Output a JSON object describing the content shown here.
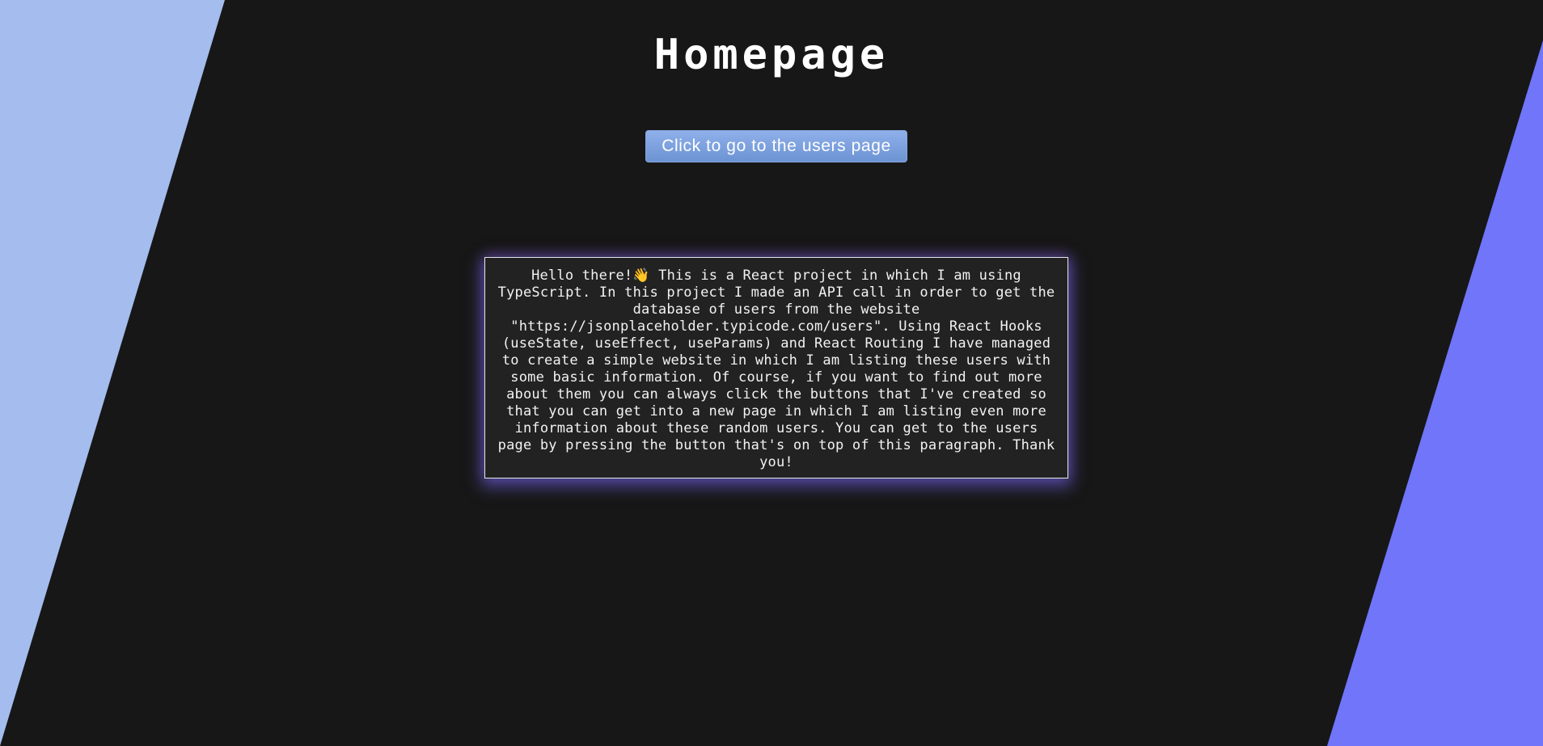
{
  "colors": {
    "background": "#171717",
    "left_shape": "#a4bcee",
    "right_shape": "#7075fa",
    "button_top": "#8fb0ea",
    "button_bottom": "#6c93d3"
  },
  "header": {
    "title": "Homepage"
  },
  "main": {
    "users_button_label": "Click to go to the users page",
    "intro_text": "Hello there!👋 This is a React project in which I am using TypeScript. In this project I made an API call in order to get the database of users from the website \"https://jsonplaceholder.typicode.com/users\". Using React Hooks (useState, useEffect, useParams) and React Routing I have managed to create a simple website in which I am listing these users with some basic information. Of course, if you want to find out more about them you can always click the buttons that I've created so that you can get into a new page in which I am listing even more information about these random users. You can get to the users page by pressing the button that's on top of this paragraph. Thank you!"
  }
}
